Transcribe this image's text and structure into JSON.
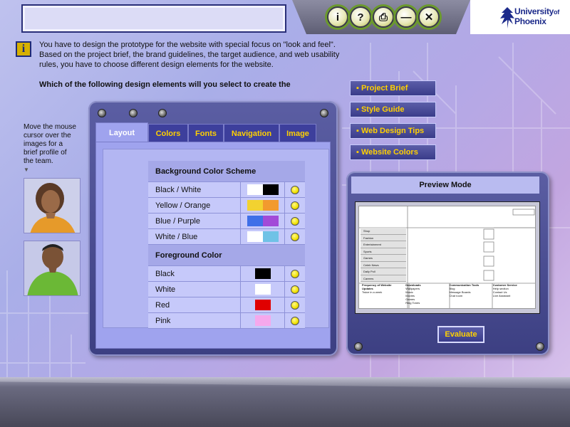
{
  "window": {
    "title": ""
  },
  "toolbar": {
    "buttons": [
      {
        "glyph": "i"
      },
      {
        "glyph": "?"
      },
      {
        "glyph": "⎙"
      },
      {
        "glyph": "—"
      },
      {
        "glyph": "✕"
      }
    ]
  },
  "logo": {
    "line1": "University",
    "line1_of": "of",
    "line2": "Phoenix"
  },
  "instructions": {
    "icon": "i",
    "text": "You have to design the prototype for the website with special focus on \"look and feel\". Based on the project brief, the brand guidelines, the target audience, and web usability rules, you have to choose different design elements for the website.",
    "question": "Which of the following design elements will you select to create the"
  },
  "team": {
    "hint": "Move the mouse cursor over the images for a brief profile of the team.",
    "arrow": "▼"
  },
  "tabs": [
    {
      "label": "Layout",
      "active": true
    },
    {
      "label": "Colors",
      "active": false
    },
    {
      "label": "Fonts",
      "active": false
    },
    {
      "label": "Navigation",
      "active": false
    },
    {
      "label": "Image",
      "active": false
    }
  ],
  "background": {
    "heading": "Background Color Scheme",
    "options": [
      {
        "label": "Black / White",
        "colors": [
          "#ffffff",
          "#000000"
        ]
      },
      {
        "label": "Yellow / Orange",
        "colors": [
          "#f2d230",
          "#f29a2e"
        ]
      },
      {
        "label": "Blue / Purple",
        "colors": [
          "#3f6fe8",
          "#a24ad8"
        ]
      },
      {
        "label": "White / Blue",
        "colors": [
          "#ffffff",
          "#6fc2e6"
        ]
      }
    ]
  },
  "foreground": {
    "heading": "Foreground Color",
    "options": [
      {
        "label": "Black",
        "color": "#000000"
      },
      {
        "label": "White",
        "color": "#ffffff"
      },
      {
        "label": "Red",
        "color": "#e00000"
      },
      {
        "label": "Pink",
        "color": "#f5a8ec"
      }
    ]
  },
  "side_buttons": [
    {
      "label": "▪ Project Brief"
    },
    {
      "label": "▪ Style Guide"
    },
    {
      "label": "▪ Web Design Tips"
    },
    {
      "label": "▪ Website Colors"
    }
  ],
  "preview": {
    "title": "Preview Mode",
    "menu": [
      "Shop",
      "Fashion",
      "Entertainment",
      "Sports",
      "Games",
      "Celeb News",
      "Daily Poll",
      "Careers"
    ],
    "columns": [
      {
        "head": "Frequency of Website Updates",
        "lines": [
          "Twice in a week"
        ]
      },
      {
        "head": "Downloads",
        "lines": [
          "Wallpapers",
          "Music",
          "Movies",
          "Games",
          "Ring Tones"
        ]
      },
      {
        "head": "Communication Tools",
        "lines": [
          "Blog",
          "Message Boards",
          "Chat room"
        ]
      },
      {
        "head": "Customer Service",
        "lines": [
          "Help section",
          "Contact Us",
          "Live Assistant"
        ]
      }
    ]
  },
  "evaluate": {
    "label": "Evaluate"
  }
}
